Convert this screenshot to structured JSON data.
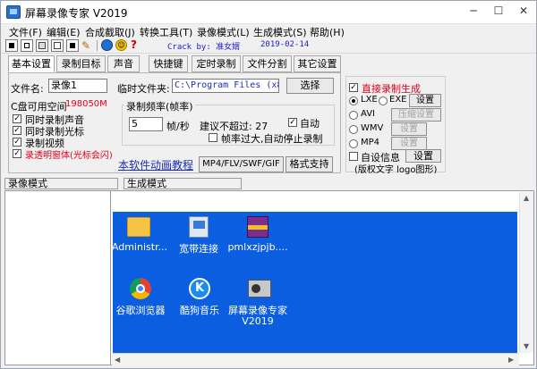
{
  "window": {
    "title": "屏幕录像专家 V2019",
    "icon": "app-icon",
    "buttons": [
      "minimize",
      "maximize",
      "close"
    ],
    "minimize_glyph": "─",
    "maximize_glyph": "☐",
    "close_glyph": "✕"
  },
  "menu": [
    "文件(F)",
    "编辑(E)",
    "合成截取(J)",
    "转换工具(T)",
    "录像模式(L)",
    "生成模式(S)",
    "帮助(H)"
  ],
  "toolbar": {
    "crack_text": "Crack by: 准女婿",
    "date_text": "2019-02-14"
  },
  "tabs": [
    "基本设置",
    "录制目标",
    "声音",
    "快捷键",
    "定时录制",
    "文件分割",
    "其它设置"
  ],
  "basic": {
    "filename_label": "文件名:",
    "filename_value": "录像1",
    "tempdir_label": "临时文件夹:",
    "tempdir_value": "C:\\Program Files (x86)",
    "browse_button": "选择",
    "disk_space_label": "C盘可用空间",
    "disk_space_value": "198050M",
    "check_sound": "同时录制声音",
    "check_cursor": "同时录制光标",
    "check_video": "录制视频",
    "check_transparent": "录透明窗体(光标会闪)",
    "frame_group": "录制频率(帧率)",
    "frame_value": "5",
    "frame_unit": "帧/秒",
    "suggest_text": "建议不超过: 27",
    "auto_label": "自动",
    "stop_label": "帧率过大,自动停止录制",
    "tutorial_link": "本软件动画教程",
    "formats_label": "MP4/FLV/SWF/GIF",
    "formats_button": "格式支持"
  },
  "output": {
    "direct_label": "直接录制生成",
    "options": [
      {
        "name": "LXE",
        "alt": "EXE",
        "button": "设置",
        "enabled": true
      },
      {
        "name": "AVI",
        "button": "压缩设置",
        "enabled": false
      },
      {
        "name": "WMV",
        "button": "设置",
        "enabled": false
      },
      {
        "name": "MP4",
        "button": "设置",
        "enabled": false
      }
    ],
    "custom_info": "自设信息",
    "custom_button": "设置",
    "custom_note": "(版权文字 logo图形)"
  },
  "panes": {
    "left_title": "录像模式",
    "right_title": "生成模式"
  },
  "desktop_icons": [
    {
      "label": "Administr...",
      "icon": "folder-icon"
    },
    {
      "label": "宽带连接",
      "icon": "network-icon"
    },
    {
      "label": "pmlxzjpjb....",
      "icon": "winrar-icon"
    },
    {
      "label": "谷歌浏览器",
      "icon": "chrome-icon"
    },
    {
      "label": "酷狗音乐",
      "icon": "kugou-icon"
    },
    {
      "label": "屏幕录像专家",
      "label2": "V2019",
      "icon": "recorder-icon"
    }
  ],
  "colors": {
    "desktop_bg": "#0b5ee0",
    "accent_red": "#e4001a",
    "link_blue": "#1c2db3"
  }
}
